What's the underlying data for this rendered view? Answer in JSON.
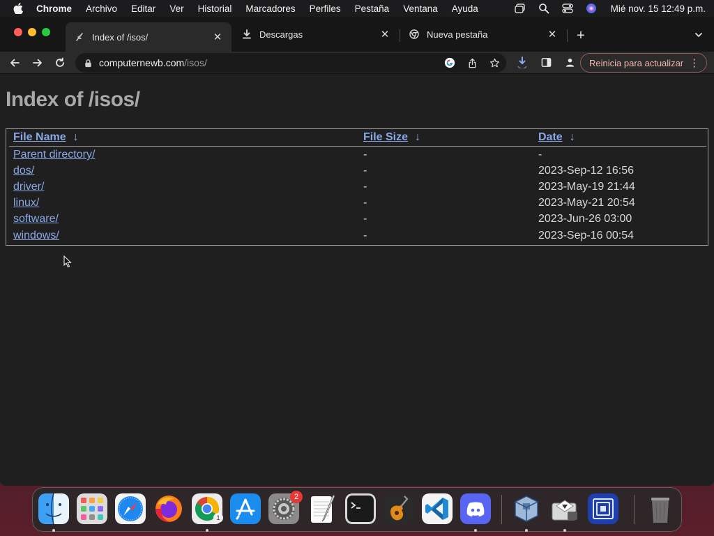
{
  "menubar": {
    "app_name": "Chrome",
    "items": [
      "Archivo",
      "Editar",
      "Ver",
      "Historial",
      "Marcadores",
      "Perfiles",
      "Pestaña",
      "Ventana",
      "Ayuda"
    ],
    "clock": "Mié nov. 15  12:49 p.m."
  },
  "tabs": [
    {
      "title": "Index of /isos/",
      "icon": "apache-feather-icon",
      "active": true
    },
    {
      "title": "Descargas",
      "icon": "download-icon",
      "active": false
    },
    {
      "title": "Nueva pestaña",
      "icon": "chrome-icon",
      "active": false
    }
  ],
  "address_bar": {
    "host": "computernewb.com",
    "path": "/isos/"
  },
  "restart_button": "Reinicia para actualizar",
  "page": {
    "title": "Index of /isos/",
    "headers": {
      "name": "File Name",
      "size": "File Size",
      "date": "Date",
      "arrow": "↓"
    },
    "rows": [
      {
        "name": "Parent directory/",
        "size": "-",
        "date": "-"
      },
      {
        "name": "dos/",
        "size": "-",
        "date": "2023-Sep-12 16:56"
      },
      {
        "name": "driver/",
        "size": "-",
        "date": "2023-May-19 21:44"
      },
      {
        "name": "linux/",
        "size": "-",
        "date": "2023-May-21 20:54"
      },
      {
        "name": "software/",
        "size": "-",
        "date": "2023-Jun-26 03:00"
      },
      {
        "name": "windows/",
        "size": "-",
        "date": "2023-Sep-16 00:54"
      }
    ]
  },
  "dock": {
    "apps": [
      {
        "name": "finder"
      },
      {
        "name": "launchpad"
      },
      {
        "name": "safari"
      },
      {
        "name": "firefox"
      },
      {
        "name": "chrome",
        "badge": "1"
      },
      {
        "name": "app-store"
      },
      {
        "name": "system-settings",
        "badge": "2"
      },
      {
        "name": "textedit"
      },
      {
        "name": "terminal"
      },
      {
        "name": "garageband"
      },
      {
        "name": "vscode"
      },
      {
        "name": "discord"
      },
      {
        "name": "virtualbox"
      },
      {
        "name": "boot-camp"
      },
      {
        "name": "screen-sharing"
      },
      {
        "name": "trash"
      }
    ]
  },
  "colors": {
    "link": "#8aa8e8",
    "restart_text": "#f3b8b0",
    "heading": "#a8a8a8"
  }
}
